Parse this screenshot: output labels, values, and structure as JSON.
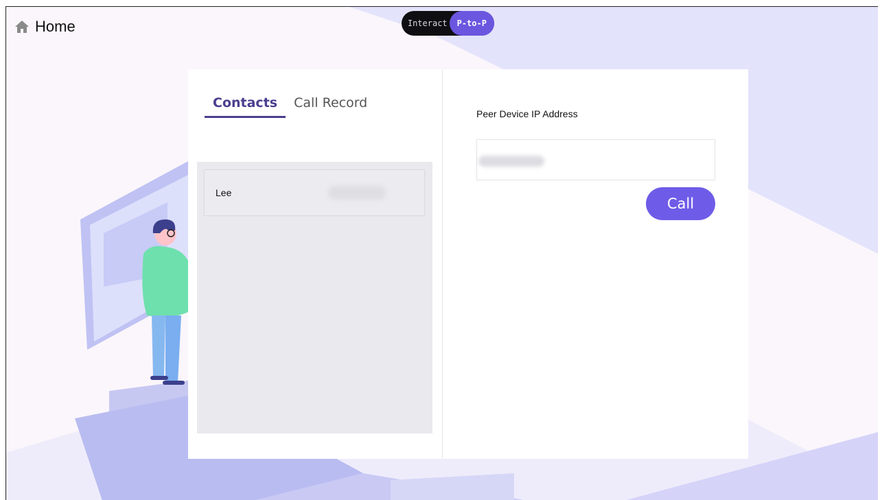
{
  "header": {
    "home_label": "Home",
    "home_icon": "home-icon"
  },
  "mode_toggle": {
    "options": [
      "Interact",
      "P-to-P"
    ],
    "selected": "P-to-P"
  },
  "contacts_panel": {
    "tabs": [
      {
        "label": "Contacts",
        "active": true
      },
      {
        "label": "Call Record",
        "active": false
      }
    ],
    "contacts": [
      {
        "name": "Lee"
      }
    ]
  },
  "call_panel": {
    "ip_label": "Peer Device IP Address",
    "ip_value": "",
    "call_label": "Call"
  },
  "colors": {
    "accent": "#6e5ce8",
    "tab_active": "#4a3f8f",
    "list_bg": "#e9e9ee",
    "toggle_bg": "#0f0f12"
  }
}
